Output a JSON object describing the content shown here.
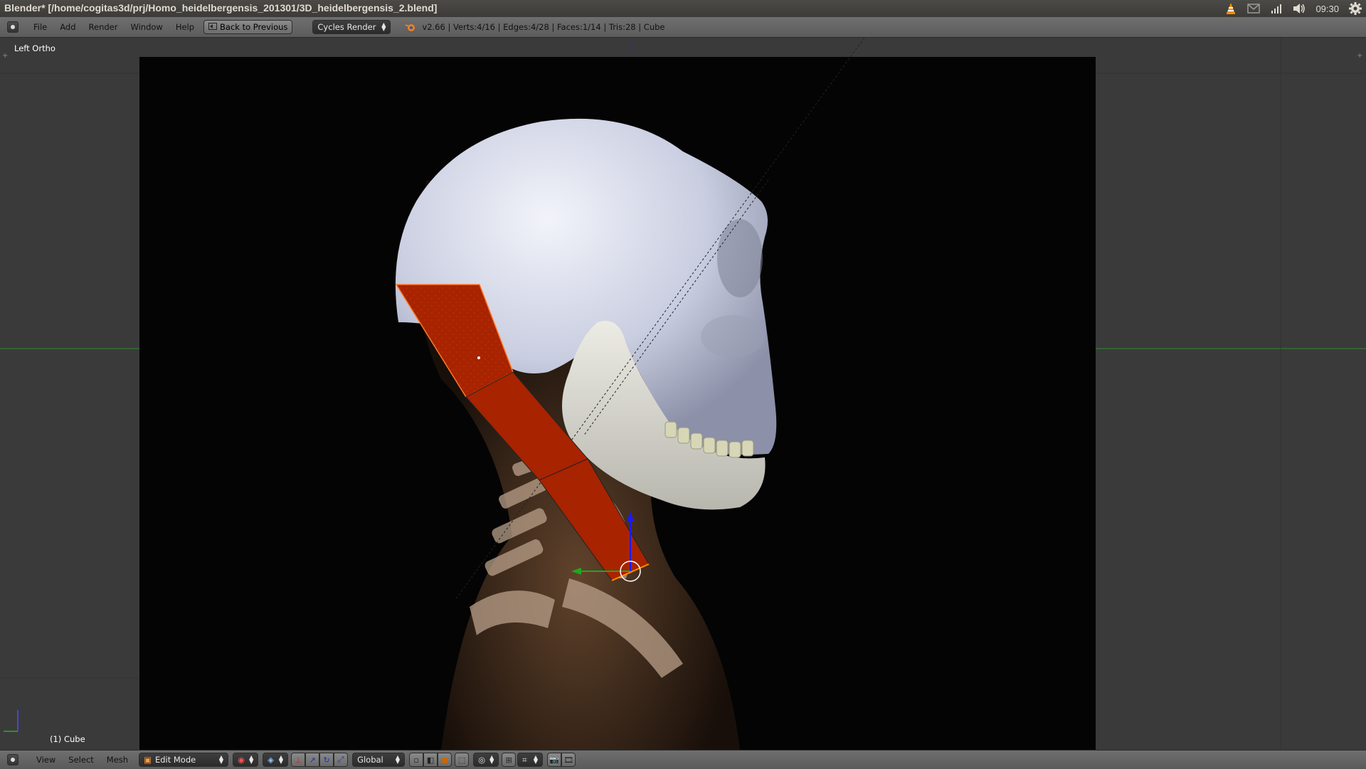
{
  "os": {
    "window_title": "Blender* [/home/cogitas3d/prj/Homo_heidelbergensis_201301/3D_heidelbergensis_2.blend]",
    "clock": "09:30",
    "tray_icons": [
      "vlc-icon",
      "mail-icon",
      "network-icon",
      "volume-icon",
      "settings-gear-icon"
    ]
  },
  "info_header": {
    "menus": [
      "File",
      "Add",
      "Render",
      "Window",
      "Help"
    ],
    "back_button": "Back to Previous",
    "render_engine": "Cycles Render",
    "stats": "v2.66 | Verts:4/16 | Edges:4/28 | Faces:1/14 | Tris:28 | Cube"
  },
  "viewport": {
    "view_label": "Left Ortho",
    "object_label": "(1) Cube"
  },
  "view_header": {
    "menus": [
      "View",
      "Select",
      "Mesh"
    ],
    "mode": "Edit Mode",
    "orientation": "Global"
  },
  "colors": {
    "mesh_face": "#a82300",
    "viewport_bg": "#3a3a3a",
    "axis_green": "#1fa81f",
    "axis_blue": "#1a1aff"
  }
}
